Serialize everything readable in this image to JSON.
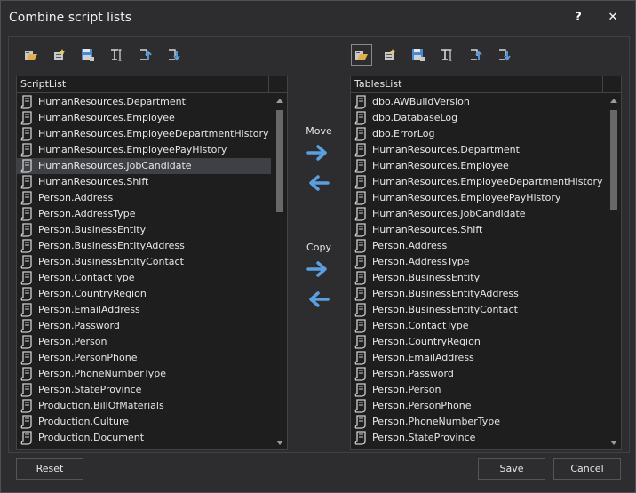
{
  "window": {
    "title": "Combine script lists",
    "help_label": "?",
    "close_label": "✕"
  },
  "left_toolbar": [
    "folder-open-icon",
    "new-script-icon",
    "save-icon",
    "rename-icon",
    "move-up-icon",
    "move-down-icon"
  ],
  "right_toolbar": [
    "folder-open-icon",
    "new-script-icon",
    "save-icon",
    "rename-icon",
    "move-up-icon",
    "move-down-icon"
  ],
  "left_list": {
    "header": "ScriptList",
    "selected_index": 4,
    "items": [
      "HumanResources.Department",
      "HumanResources.Employee",
      "HumanResources.EmployeeDepartmentHistory",
      "HumanResources.EmployeePayHistory",
      "HumanResources.JobCandidate",
      "HumanResources.Shift",
      "Person.Address",
      "Person.AddressType",
      "Person.BusinessEntity",
      "Person.BusinessEntityAddress",
      "Person.BusinessEntityContact",
      "Person.ContactType",
      "Person.CountryRegion",
      "Person.EmailAddress",
      "Person.Password",
      "Person.Person",
      "Person.PersonPhone",
      "Person.PhoneNumberType",
      "Person.StateProvince",
      "Production.BillOfMaterials",
      "Production.Culture",
      "Production.Document"
    ]
  },
  "right_list": {
    "header": "TablesList",
    "items": [
      "dbo.AWBuildVersion",
      "dbo.DatabaseLog",
      "dbo.ErrorLog",
      "HumanResources.Department",
      "HumanResources.Employee",
      "HumanResources.EmployeeDepartmentHistory",
      "HumanResources.EmployeePayHistory",
      "HumanResources.JobCandidate",
      "HumanResources.Shift",
      "Person.Address",
      "Person.AddressType",
      "Person.BusinessEntity",
      "Person.BusinessEntityAddress",
      "Person.BusinessEntityContact",
      "Person.ContactType",
      "Person.CountryRegion",
      "Person.EmailAddress",
      "Person.Password",
      "Person.Person",
      "Person.PersonPhone",
      "Person.PhoneNumberType",
      "Person.StateProvince"
    ]
  },
  "middle": {
    "move_label": "Move",
    "copy_label": "Copy"
  },
  "buttons": {
    "reset": "Reset",
    "save": "Save",
    "cancel": "Cancel"
  },
  "colors": {
    "background": "#2d2d30",
    "list_background": "#1e1e1e",
    "selection": "#3f3f46",
    "arrow": "#5aa0e0"
  }
}
